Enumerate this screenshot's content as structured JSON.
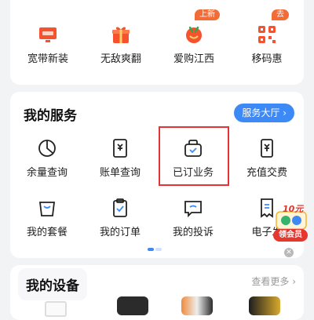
{
  "quick_actions": [
    {
      "label": "宽带新装",
      "icon": "broadband-tv-icon",
      "tag": ""
    },
    {
      "label": "无敌爽翻",
      "icon": "gift-box-icon",
      "tag": ""
    },
    {
      "label": "爱购江西",
      "icon": "shopping-mascot-icon",
      "tag": "上新"
    },
    {
      "label": "移码惠",
      "icon": "qr-code-icon",
      "tag": "去"
    }
  ],
  "services": {
    "title": "我的服务",
    "hall_button": "服务大厅 ›",
    "items": [
      {
        "label": "余量查询",
        "icon": "usage-pie-icon"
      },
      {
        "label": "账单查询",
        "icon": "bill-document-icon"
      },
      {
        "label": "已订业务",
        "icon": "subscribed-package-icon"
      },
      {
        "label": "充值交费",
        "icon": "recharge-phone-icon"
      },
      {
        "label": "我的套餐",
        "icon": "plan-bag-icon"
      },
      {
        "label": "我的订单",
        "icon": "order-clipboard-icon"
      },
      {
        "label": "我的投诉",
        "icon": "complaint-chat-icon"
      },
      {
        "label": "电子发",
        "icon": "e-invoice-icon"
      }
    ]
  },
  "promo": {
    "cash": "10元",
    "badge": "领会员"
  },
  "devices": {
    "title": "我的设备",
    "more": "查看更多 ›"
  },
  "colors": {
    "accent": "#3d8af7",
    "highlight": "#e3342f",
    "tag": "#f36b35"
  }
}
